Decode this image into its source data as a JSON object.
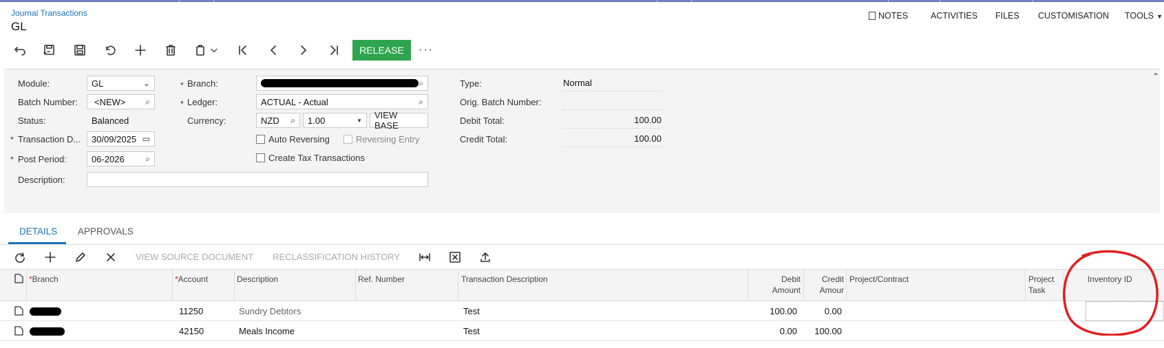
{
  "breadcrumb": "Journal Transactions",
  "page_title": "GL",
  "header_links": {
    "notes": "NOTES",
    "activities": "ACTIVITIES",
    "files": "FILES",
    "customisation": "CUSTOMISATION",
    "tools": "TOOLS"
  },
  "toolbar": {
    "release_label": "RELEASE",
    "more_label": "···"
  },
  "form": {
    "module_label": "Module:",
    "module_value": "GL",
    "batch_label": "Batch Number:",
    "batch_value": "<NEW>",
    "status_label": "Status:",
    "status_value": "Balanced",
    "trans_date_label": "Transaction D...",
    "trans_date_value": "30/09/2025",
    "post_period_label": "Post Period:",
    "post_period_value": "06-2026",
    "description_label": "Description:",
    "description_value": "",
    "branch_label": "Branch:",
    "ledger_label": "Ledger:",
    "ledger_value": "ACTUAL - Actual",
    "currency_label": "Currency:",
    "currency_value": "NZD",
    "rate_value": "1.00",
    "view_base_label": "VIEW BASE",
    "auto_reversing_label": "Auto Reversing",
    "reversing_entry_label": "Reversing Entry",
    "create_tax_label": "Create Tax Transactions",
    "type_label": "Type:",
    "type_value": "Normal",
    "orig_batch_label": "Orig. Batch Number:",
    "orig_batch_value": "",
    "debit_total_label": "Debit Total:",
    "debit_total_value": "100.00",
    "credit_total_label": "Credit Total:",
    "credit_total_value": "100.00",
    "required_mark": "*"
  },
  "tabs": {
    "details": "DETAILS",
    "approvals": "APPROVALS"
  },
  "grid_toolbar": {
    "view_source": "VIEW SOURCE DOCUMENT",
    "reclass_history": "RECLASSIFICATION HISTORY"
  },
  "grid": {
    "headers": {
      "branch": "Branch",
      "account": "Account",
      "description": "Description",
      "ref_number": "Ref. Number",
      "transaction_description": "Transaction Description",
      "debit_line1": "Debit",
      "debit_line2": "Amount",
      "credit_line1": "Credit",
      "credit_line2": "Amour",
      "project_contract": "Project/Contract",
      "project_task_line1": "Project",
      "project_task_line2": "Task",
      "inventory_id": "Inventory ID"
    },
    "rows": [
      {
        "account": "11250",
        "description": "Sundry Debtors",
        "transaction_description": "Test",
        "debit": "100.00",
        "credit": "0.00"
      },
      {
        "account": "42150",
        "description": "Meals Income",
        "transaction_description": "Test",
        "debit": "0.00",
        "credit": "100.00"
      }
    ]
  },
  "colors": {
    "accent": "#1a73b8",
    "release": "#2ea44f",
    "annotation": "#e02020"
  }
}
